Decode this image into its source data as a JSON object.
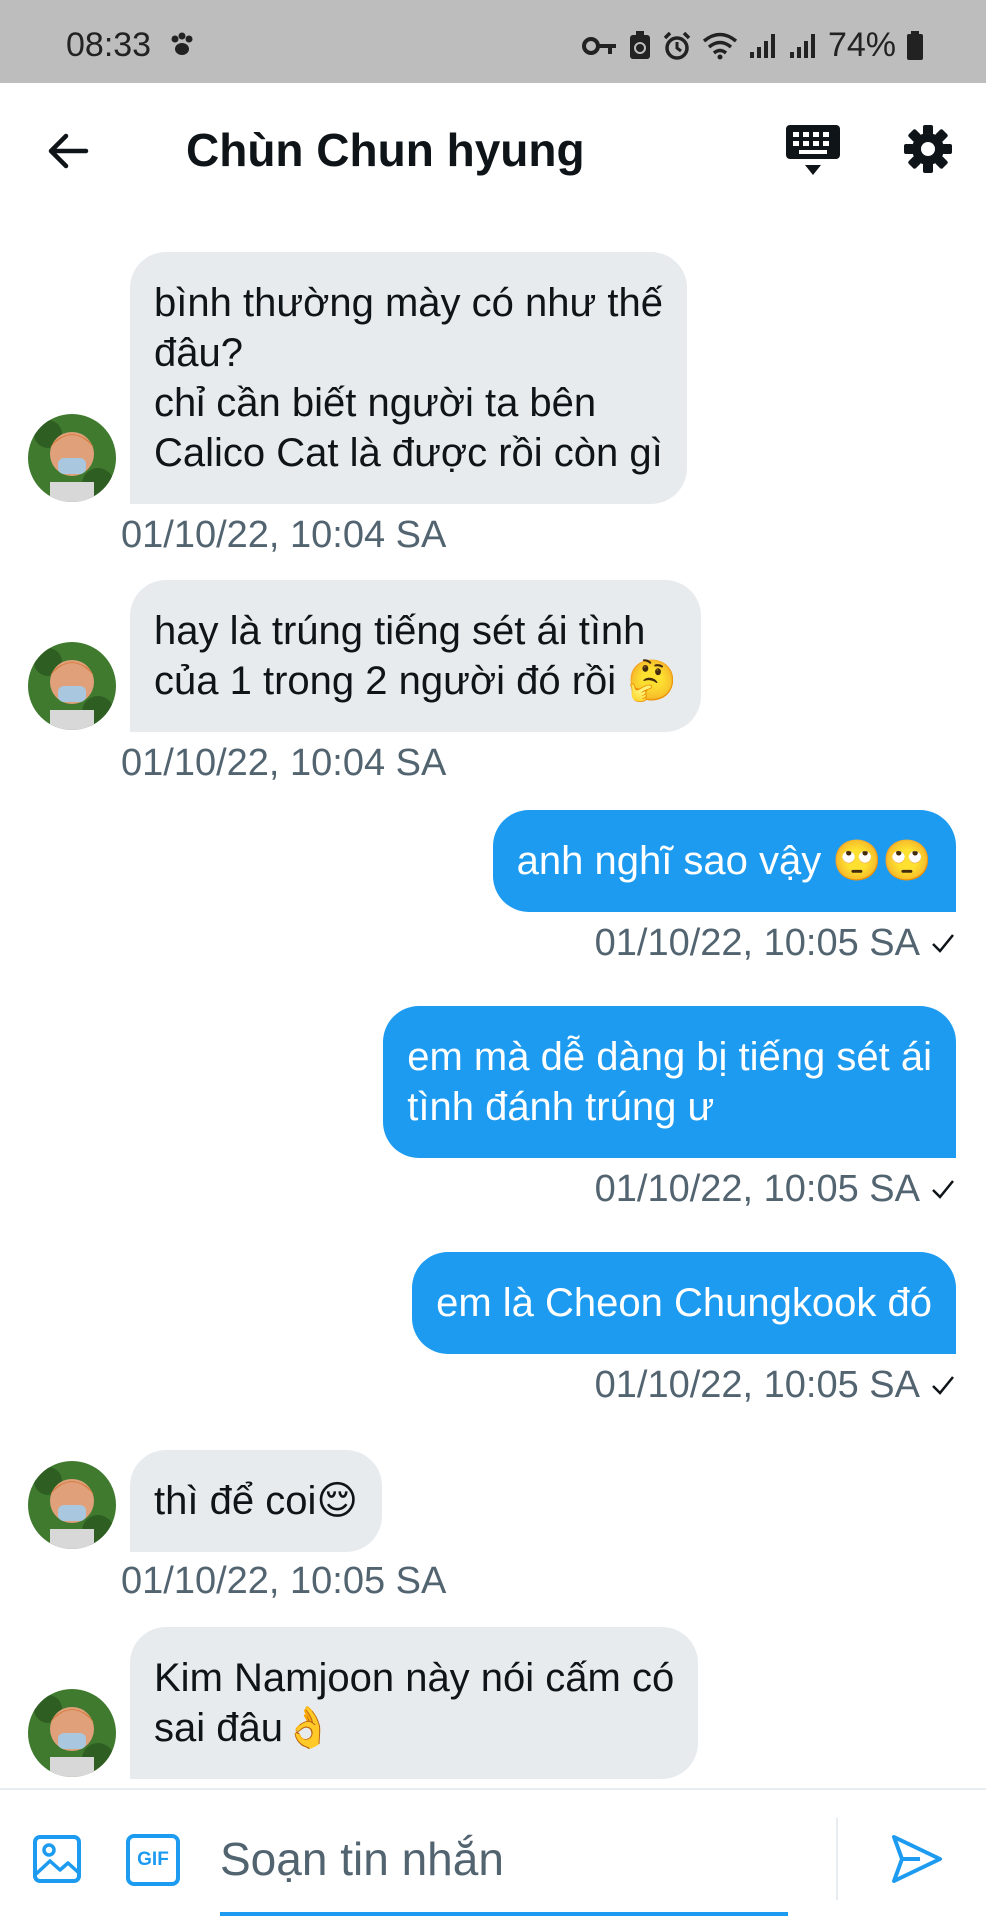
{
  "status_bar": {
    "time": "08:33",
    "battery": "74%"
  },
  "header": {
    "title": "Chùn Chun hyung"
  },
  "messages": [
    {
      "direction": "in",
      "lines": [
        "bình thường mày có như thế",
        "đâu?",
        "chỉ cần biết người ta bên",
        "Calico Cat là được rồi còn gì"
      ],
      "timestamp": "01/10/22, 10:04 SA"
    },
    {
      "direction": "in",
      "lines": [
        "hay là trúng tiếng sét ái tình",
        "của 1 trong 2 người đó rồi 🤔"
      ],
      "timestamp": "01/10/22, 10:04 SA"
    },
    {
      "direction": "out",
      "lines": [
        "anh nghĩ sao vậy 🙄🙄"
      ],
      "timestamp": "01/10/22, 10:05 SA"
    },
    {
      "direction": "out",
      "lines": [
        "em mà dễ dàng bị tiếng sét ái",
        "tình đánh trúng ư"
      ],
      "timestamp": "01/10/22, 10:05 SA"
    },
    {
      "direction": "out",
      "lines": [
        "em là Cheon Chungkook đó"
      ],
      "timestamp": "01/10/22, 10:05 SA"
    },
    {
      "direction": "in",
      "lines": [
        "thì để coi😌"
      ],
      "timestamp": "01/10/22, 10:05 SA"
    },
    {
      "direction": "in",
      "lines": [
        "Kim Namjoon này nói cấm có",
        "sai đâu👌"
      ],
      "timestamp": ""
    }
  ],
  "composer": {
    "placeholder": "Soạn tin nhắn",
    "gif_label": "GIF"
  },
  "colors": {
    "accent": "#1d9bf0",
    "incoming_bubble": "#e7ebee",
    "timestamp": "#536471",
    "status_bar": "#bdbdbd"
  },
  "icons": [
    "back-arrow-icon",
    "keyboard-icon",
    "gear-icon",
    "image-icon",
    "gif-icon",
    "send-icon",
    "paw-icon",
    "key-icon",
    "alarm-icon",
    "wifi-icon",
    "signal-icon",
    "battery-icon"
  ]
}
